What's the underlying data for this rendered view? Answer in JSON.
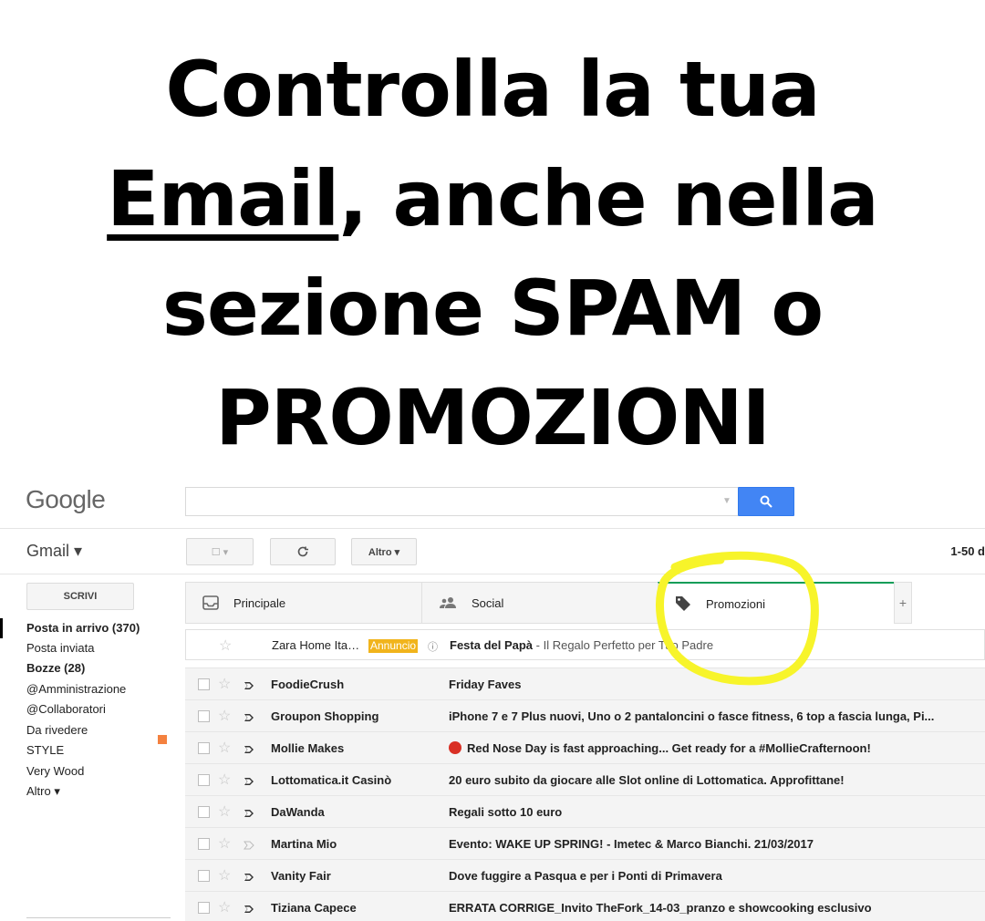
{
  "headline": {
    "line1": "Controlla la tua",
    "line2_underlined": "Email",
    "line2_rest": ", anche nella",
    "line3": "sezione SPAM o",
    "line4": "PROMOZIONI"
  },
  "header": {
    "logo": "Google",
    "search": {
      "value": "",
      "placeholder": "",
      "button_icon": "search-icon"
    }
  },
  "toolbar": {
    "app_label": "Gmail ▾",
    "select_label": "☐ ▾",
    "refresh_icon": "refresh-icon",
    "more_label": "Altro ▾",
    "pager": "1-50 d"
  },
  "sidebar": {
    "compose": "SCRIVI",
    "folders": [
      {
        "label": "Posta in arrivo (370)",
        "bold": true
      },
      {
        "label": "Posta inviata",
        "bold": false
      },
      {
        "label": "Bozze (28)",
        "bold": true
      },
      {
        "label": "@Amministrazione",
        "bold": false
      },
      {
        "label": "@Collaboratori",
        "bold": false
      },
      {
        "label": "Da rivedere",
        "bold": false,
        "color": "#f4813f"
      },
      {
        "label": "STYLE",
        "bold": false
      },
      {
        "label": "Very Wood",
        "bold": false
      },
      {
        "label": "Altro ▾",
        "bold": false
      }
    ]
  },
  "tabs": [
    {
      "label": "Principale",
      "icon": "inbox-icon",
      "active": false
    },
    {
      "label": "Social",
      "icon": "people-icon",
      "active": false
    },
    {
      "label": "Promozioni",
      "icon": "tag-icon",
      "active": true
    }
  ],
  "tab_add": "+",
  "ad": {
    "sender": "Zara Home Ita…",
    "badge": "Annuncio",
    "subject": "Festa del Papà",
    "snippet": " - Il Regalo Perfetto per Tuo Padre"
  },
  "emails": [
    {
      "sender": "FoodieCrush",
      "subject": "Friday Faves",
      "important": true
    },
    {
      "sender": "Groupon Shopping",
      "subject": "iPhone 7 e 7 Plus nuovi, Uno o 2 pantaloncini o fasce fitness, 6 top a fascia lunga, Pi...",
      "important": true
    },
    {
      "sender": "Mollie Makes",
      "subject": "Red Nose Day is fast approaching... Get ready for a #MollieCrafternoon!",
      "important": true,
      "dot": "#d93025"
    },
    {
      "sender": "Lottomatica.it Casinò",
      "subject": "20 euro subito da giocare alle Slot online di Lottomatica. Approfittane!",
      "important": true
    },
    {
      "sender": "DaWanda",
      "subject": "Regali sotto 10 euro",
      "important": true
    },
    {
      "sender": "Martina Mio",
      "subject": "Evento: WAKE UP SPRING! - Imetec & Marco Bianchi. 21/03/2017",
      "important": false
    },
    {
      "sender": "Vanity Fair",
      "subject": "Dove fuggire a Pasqua e per i Ponti di Primavera",
      "important": true
    },
    {
      "sender": "Tiziana Capece",
      "subject": "ERRATA CORRIGE_Invito TheFork_14-03_pranzo e showcooking esclusivo",
      "important": true
    }
  ],
  "colors": {
    "highlight": "#f7f42a",
    "accent_green": "#0f9d58",
    "search_blue": "#4285f4",
    "badge": "#f1b41c"
  }
}
